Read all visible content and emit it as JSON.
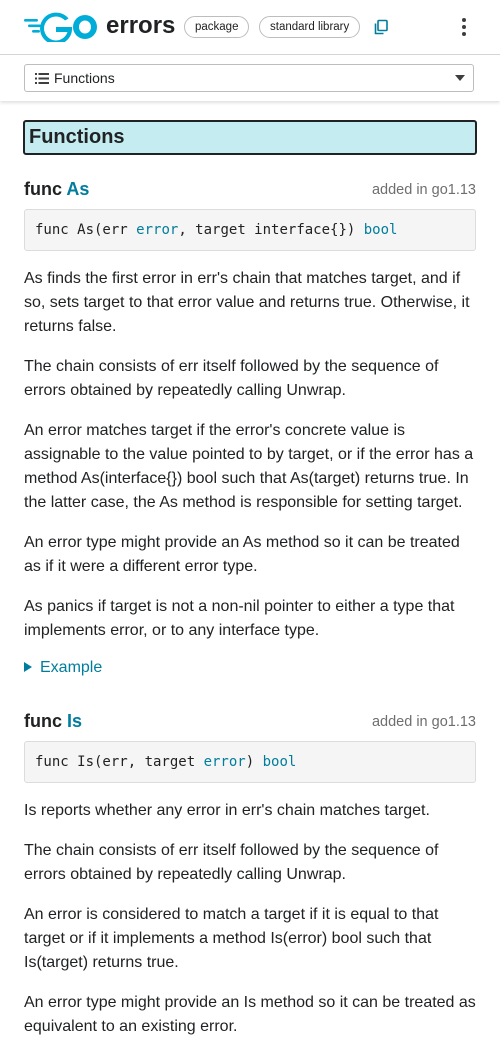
{
  "header": {
    "package_name": "errors",
    "chips": [
      "package",
      "standard library"
    ]
  },
  "jump": {
    "label": "Functions"
  },
  "section": {
    "title": "Functions"
  },
  "functions": [
    {
      "keyword": "func",
      "name": "As",
      "added": "added in go1.13",
      "signature": {
        "prefix": "func As(err ",
        "type1": "error",
        "middle": ", target interface{}) ",
        "type2": "bool"
      },
      "paragraphs": [
        "As finds the first error in err's chain that matches target, and if so, sets target to that error value and returns true. Otherwise, it returns false.",
        "The chain consists of err itself followed by the sequence of errors obtained by repeatedly calling Unwrap.",
        "An error matches target if the error's concrete value is assignable to the value pointed to by target, or if the error has a method As(interface{}) bool such that As(target) returns true. In the latter case, the As method is responsible for setting target.",
        "An error type might provide an As method so it can be treated as if it were a different error type.",
        "As panics if target is not a non-nil pointer to either a type that implements error, or to any interface type."
      ],
      "example_label": "Example"
    },
    {
      "keyword": "func",
      "name": "Is",
      "added": "added in go1.13",
      "signature": {
        "prefix": "func Is(err, target ",
        "type1": "error",
        "middle": ") ",
        "type2": "bool"
      },
      "paragraphs": [
        "Is reports whether any error in err's chain matches target.",
        "The chain consists of err itself followed by the sequence of errors obtained by repeatedly calling Unwrap.",
        "An error is considered to match a target if it is equal to that target or if it implements a method Is(error) bool such that Is(target) returns true.",
        "An error type might provide an Is method so it can be treated as equivalent to an existing error."
      ]
    }
  ],
  "colors": {
    "go_blue": "#00add8",
    "link_teal": "#007d9c",
    "heading_bg": "#c4ecf1"
  },
  "icons": [
    "go-logo",
    "copy-icon",
    "kebab-menu-icon",
    "list-icon",
    "dropdown-arrow-icon",
    "disclosure-triangle-icon"
  ]
}
